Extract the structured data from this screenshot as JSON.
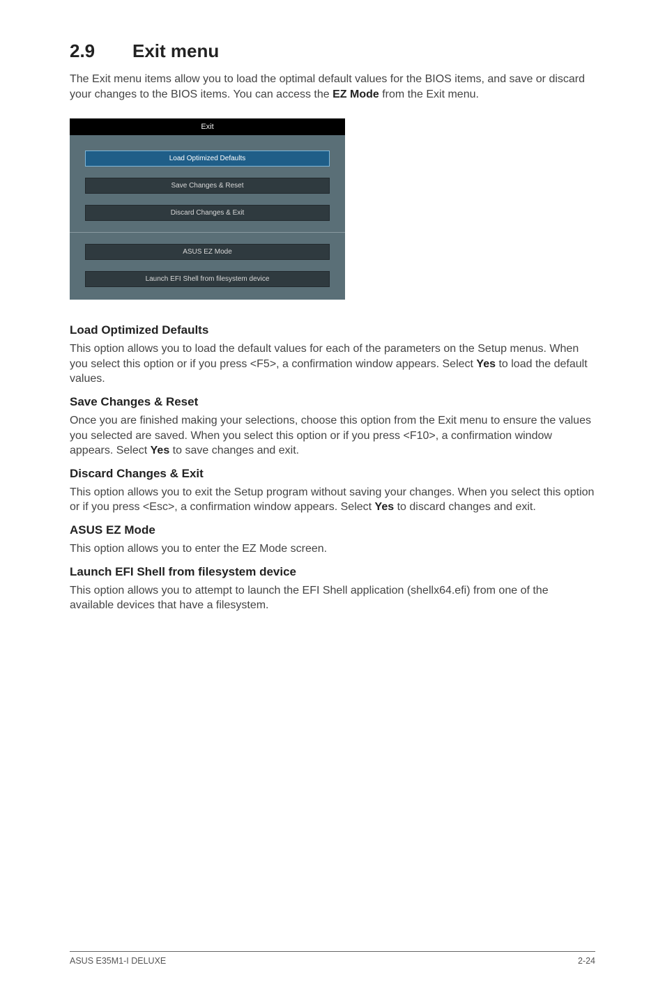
{
  "heading": {
    "number": "2.9",
    "title": "Exit menu"
  },
  "intro": {
    "pre": "The Exit menu items allow you to load the optimal default values for the BIOS items, and save or discard your changes to the BIOS items. You can access the ",
    "bold": "EZ Mode",
    "post": " from the Exit menu."
  },
  "panel": {
    "title": "Exit",
    "buttons": {
      "load_defaults": "Load Optimized Defaults",
      "save_reset": "Save Changes & Reset",
      "discard_exit": "Discard Changes & Exit",
      "ez_mode": "ASUS EZ Mode",
      "launch_efi": "Launch EFI Shell from filesystem device"
    }
  },
  "sections": {
    "load_defaults": {
      "title": "Load Optimized Defaults",
      "p1_pre": "This option allows you to load the default values for each of the parameters on the Setup menus. When you select this option or if you press <F5>, a confirmation window appears. Select ",
      "p1_bold": "Yes",
      "p1_post": " to load the default values."
    },
    "save_reset": {
      "title": "Save Changes & Reset",
      "p1_pre": "Once you are finished making your selections, choose this option from the Exit menu to ensure the values you selected are saved. When you select this option or if you press <F10>, a confirmation window appears. Select ",
      "p1_bold": "Yes",
      "p1_post": " to save changes and exit."
    },
    "discard_exit": {
      "title": "Discard Changes & Exit",
      "p1_pre": "This option allows you to exit the Setup program without saving your changes. When you select this option or if you press <Esc>, a confirmation window appears. Select ",
      "p1_bold": "Yes",
      "p1_post": " to discard changes and exit."
    },
    "ez_mode": {
      "title": "ASUS EZ Mode",
      "p1": "This option allows you to enter the EZ Mode screen."
    },
    "launch_efi": {
      "title": "Launch EFI Shell from filesystem device",
      "p1": "This option allows you to attempt to launch the EFI Shell application (shellx64.efi) from one of the available devices that have a filesystem."
    }
  },
  "footer": {
    "left": "ASUS E35M1-I DELUXE",
    "right": "2-24"
  }
}
